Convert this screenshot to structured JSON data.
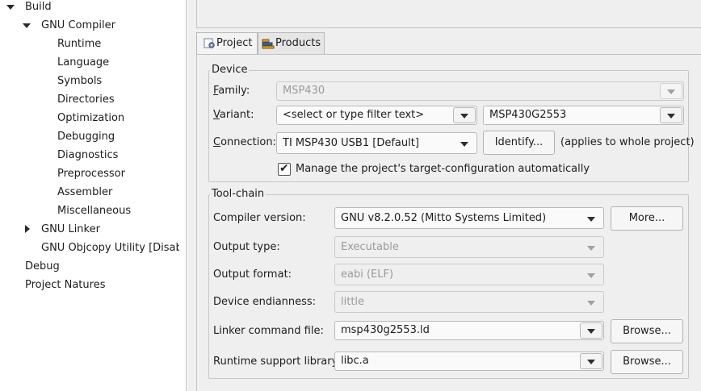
{
  "tree": {
    "items": [
      {
        "label": "Build",
        "expander": "expanded"
      },
      {
        "label": "GNU Compiler",
        "expander": "expanded"
      },
      {
        "label": "Runtime"
      },
      {
        "label": "Language"
      },
      {
        "label": "Symbols"
      },
      {
        "label": "Directories"
      },
      {
        "label": "Optimization"
      },
      {
        "label": "Debugging"
      },
      {
        "label": "Diagnostics"
      },
      {
        "label": "Preprocessor"
      },
      {
        "label": "Assembler"
      },
      {
        "label": "Miscellaneous"
      },
      {
        "label": "GNU Linker",
        "expander": "collapsed"
      },
      {
        "label": "GNU Objcopy Utility  [Disabled]"
      },
      {
        "label": "Debug"
      },
      {
        "label": "Project Natures"
      }
    ]
  },
  "tabs": [
    {
      "label": "Project",
      "icon": "project-settings-icon"
    },
    {
      "label": "Products",
      "icon": "products-icon"
    }
  ],
  "device": {
    "title": "Device",
    "family_label": "Family:",
    "family_value": "MSP430",
    "variant_label": "Variant:",
    "variant_filter": "<select or type filter text>",
    "variant_value": "MSP430G2553",
    "connection_label": "Connection:",
    "connection_value": "TI MSP430 USB1 [Default]",
    "identify_button": "Identify...",
    "identify_note": "(applies to whole project)",
    "manage_label": "Manage the project's target-configuration automatically",
    "manage_checked": true
  },
  "toolchain": {
    "title": "Tool-chain",
    "compiler_label": "Compiler version:",
    "compiler_value": "GNU v8.2.0.52 (Mitto Systems Limited)",
    "more_button": "More...",
    "output_type_label": "Output type:",
    "output_type_value": "Executable",
    "output_format_label": "Output format:",
    "output_format_value": "eabi (ELF)",
    "endianness_label": "Device endianness:",
    "endianness_value": "little",
    "linker_label": "Linker command file:",
    "linker_value": "msp430g2553.ld",
    "browse_button": "Browse...",
    "runtime_label": "Runtime support library:",
    "runtime_value": "libc.a"
  }
}
